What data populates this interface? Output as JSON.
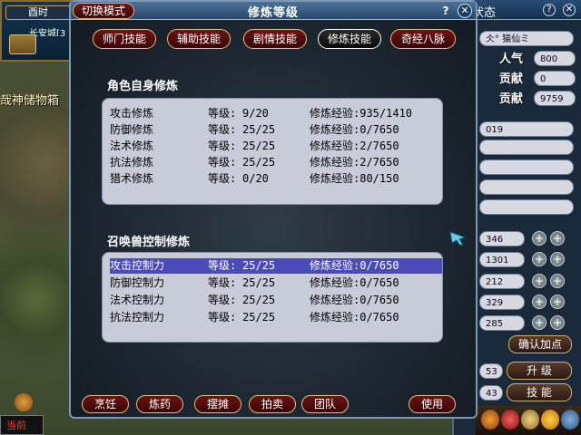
{
  "game": {
    "minimap_time": "酉时",
    "city_name": "长安城[3",
    "banner_text": "哉神储物箱",
    "chat_channel": "当前"
  },
  "right_panel": {
    "title": "状态",
    "help": "?",
    "close": "✕",
    "name_value": "仌° 猫仙ミ",
    "popularity_label": "人气",
    "popularity_value": "800",
    "contrib_label_1": "贡献",
    "contrib_value_1": "0",
    "contrib_label_2": "贡献",
    "contrib_value_2": "9759",
    "field_id": "019",
    "stats": [
      "346",
      "1301",
      "212",
      "329",
      "285"
    ],
    "confirm_label": "确认加点",
    "lvl_value": "53",
    "upgrade_label": "升 级",
    "skill_value": "43",
    "skill_label": "技 能"
  },
  "dialog": {
    "title": "修炼等级",
    "switch_mode": "切换模式",
    "help": "?",
    "close": "✕",
    "tabs": [
      {
        "label": "师门技能",
        "active": false
      },
      {
        "label": "辅助技能",
        "active": false
      },
      {
        "label": "剧情技能",
        "active": false
      },
      {
        "label": "修炼技能",
        "active": true
      },
      {
        "label": "奇经八脉",
        "active": false
      }
    ],
    "self_section_title": "角色自身修炼",
    "self_rows": [
      {
        "name": "攻击修炼",
        "level_label": "等级:",
        "level": "9/20",
        "exp": "修炼经验:935/1410"
      },
      {
        "name": "防御修炼",
        "level_label": "等级:",
        "level": "25/25",
        "exp": "修炼经验:0/7650"
      },
      {
        "name": "法术修炼",
        "level_label": "等级:",
        "level": "25/25",
        "exp": "修炼经验:2/7650"
      },
      {
        "name": "抗法修炼",
        "level_label": "等级:",
        "level": "25/25",
        "exp": "修炼经验:2/7650"
      },
      {
        "name": "猎术修炼",
        "level_label": "等级:",
        "level": "0/20",
        "exp": "修炼经验:80/150"
      }
    ],
    "pet_section_title": "召唤兽控制修炼",
    "pet_rows": [
      {
        "name": "攻击控制力",
        "level_label": "等级:",
        "level": "25/25",
        "exp": "修炼经验:0/7650",
        "selected": true
      },
      {
        "name": "防御控制力",
        "level_label": "等级:",
        "level": "25/25",
        "exp": "修炼经验:0/7650",
        "selected": false
      },
      {
        "name": "法术控制力",
        "level_label": "等级:",
        "level": "25/25",
        "exp": "修炼经验:0/7650",
        "selected": false
      },
      {
        "name": "抗法控制力",
        "level_label": "等级:",
        "level": "25/25",
        "exp": "修炼经验:0/7650",
        "selected": false
      }
    ],
    "bottom_buttons": [
      "烹饪",
      "炼药",
      "摆摊",
      "拍卖",
      "团队"
    ],
    "use_button": "使用"
  },
  "colors": {
    "dialog_bg": "#1e2832",
    "title_bar": "#25476b",
    "tab_red": "#6a1414",
    "panel_bg": "#c8cbd8",
    "selected_row": "#4a4ab8",
    "gold_border": "#e6c080"
  }
}
